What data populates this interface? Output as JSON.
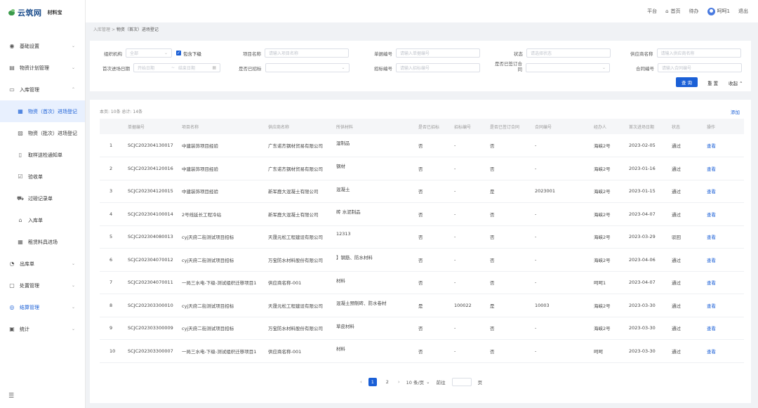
{
  "brand": {
    "name": "云筑网",
    "sub": "材料宝",
    "accent": "#1a5fd6"
  },
  "header": {
    "platform": "平台",
    "home": "首页",
    "todo": "待办",
    "user": "呵呵1",
    "logout": "退出"
  },
  "sidebar": {
    "items": [
      {
        "label": "基础设置",
        "icon": "settings-icon"
      },
      {
        "label": "物资计划管理",
        "icon": "calendar-icon"
      },
      {
        "label": "入库管理",
        "icon": "inbox-icon"
      },
      {
        "label": "出库单",
        "icon": "outbound-icon"
      },
      {
        "label": "处置管理",
        "icon": "dispose-icon"
      },
      {
        "label": "结算管理",
        "icon": "settlement-icon"
      },
      {
        "label": "统计",
        "icon": "stats-icon"
      }
    ],
    "submenu": [
      {
        "label": "物资（首次）进场登记"
      },
      {
        "label": "物资（批次）进场登记"
      },
      {
        "label": "取样送检通知单"
      },
      {
        "label": "验收单"
      },
      {
        "label": "过磅记录单"
      },
      {
        "label": "入库单"
      },
      {
        "label": "租赁料具进场"
      }
    ]
  },
  "breadcrumb": {
    "parent": "入库管理",
    "sep": ">",
    "current": "物资（首次）进场登记"
  },
  "filters": {
    "org_label": "组织机构",
    "org_value": "全部",
    "include_sub": "包含下级",
    "project_label": "项目名称",
    "project_placeholder": "请输入项目名称",
    "doc_label": "单据编号",
    "doc_placeholder": "请输入单据编号",
    "status_label": "状态",
    "status_placeholder": "请选择状态",
    "supplier_label": "供应商名称",
    "supplier_placeholder": "请输入供应商名称",
    "date_label": "首次进场日期",
    "date_start": "开始日期",
    "date_sep": "~",
    "date_end": "结束日期",
    "bid_label": "是否已招标",
    "bid_no_label": "招标编号",
    "bid_no_placeholder": "请输入招标编号",
    "contract_signed_label": "是否已签订合同",
    "contract_no_label": "合同编号",
    "contract_no_placeholder": "请输入合同编号",
    "search_btn": "查 询",
    "reset_btn": "重 置",
    "collapse_btn": "收起"
  },
  "table": {
    "count_text": "本页: 10条   总计: 14条",
    "add_text": "添加",
    "columns": [
      "",
      "单据编号",
      "项目名称",
      "供应商名称",
      "所供材料",
      "是否已招标",
      "招标编号",
      "是否已签订合同",
      "合同编号",
      "经办人",
      "首次进场日期",
      "状态",
      "操作"
    ],
    "rows": [
      [
        "1",
        "SCJC202304130017",
        "中建装饰项目经验",
        "广东诺杰钢材贸易有限公司",
        "湿制品",
        "否",
        "-",
        "否",
        "-",
        "海峡2号",
        "2023-02-05",
        "通过",
        "查看"
      ],
      [
        "2",
        "SCJC202304120016",
        "中建装饰项目经验",
        "广东诺杰钢材贸易有限公司",
        "钢材",
        "否",
        "-",
        "否",
        "-",
        "海峡2号",
        "2023-01-16",
        "通过",
        "查看"
      ],
      [
        "3",
        "SCJC202304120015",
        "中建装饰项目经验",
        "新军鹿大混凝土有限公司",
        "混凝土",
        "否",
        "-",
        "是",
        "2023001",
        "海峡2号",
        "2023-01-15",
        "通过",
        "查看"
      ],
      [
        "4",
        "SCJC202304100014",
        "2号线延长工程冷站",
        "新军鹿大混凝土有限公司",
        "砖 水泥制品",
        "否",
        "-",
        "否",
        "-",
        "海峡2号",
        "2023-04-07",
        "通过",
        "查看"
      ],
      [
        "5",
        "SCJC202304080013",
        "cyj天府二街测试项目招标",
        "天晟元松工程建设有限公司",
        "12313",
        "否",
        "-",
        "否",
        "-",
        "海峡2号",
        "2023-03-29",
        "驳回",
        "查看"
      ],
      [
        "6",
        "SCJC202304070012",
        "cyj天府二街测试项目招标",
        "万宝防水材料股份有限公司",
        "】钢筋、防水材料",
        "否",
        "-",
        "否",
        "-",
        "海峡2号",
        "2023-04-06",
        "通过",
        "查看"
      ],
      [
        "7",
        "SCJC202304070011",
        "一局三水电-下级-测试组织迁移项目1",
        "供应商名称-001",
        "材料",
        "否",
        "-",
        "否",
        "-",
        "呵呵1",
        "2023-04-07",
        "通过",
        "查看"
      ],
      [
        "8",
        "SCJC202303300010",
        "cyj天府二街测试项目招标",
        "天晟元松工程建设有限公司",
        "混凝土预制砖、防水卷材",
        "是",
        "100022",
        "是",
        "10003",
        "海峡2号",
        "2023-03-30",
        "通过",
        "查看"
      ],
      [
        "9",
        "SCJC202303300009",
        "cyj天府二街测试项目招标",
        "万宝防水材料股份有限公司",
        "草皮材料",
        "否",
        "-",
        "否",
        "-",
        "海峡2号",
        "2023-03-30",
        "通过",
        "查看"
      ],
      [
        "10",
        "SCJC202303300007",
        "一局三水电-下级-测试组织迁移项目1",
        "供应商名称-001",
        "材料",
        "否",
        "-",
        "否",
        "-",
        "呵呵",
        "2023-03-30",
        "通过",
        "查看"
      ]
    ]
  },
  "pagination": {
    "prev": "‹",
    "pages": [
      "1",
      "2"
    ],
    "next": "›",
    "page_size": "10 条/页",
    "jump_prefix": "前往",
    "jump_suffix": "页"
  }
}
